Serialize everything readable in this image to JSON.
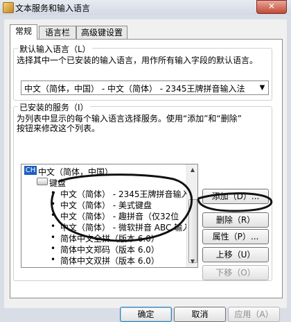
{
  "window": {
    "title": "文本服务和输入语言",
    "close_label": "✕"
  },
  "tabs": [
    {
      "label": "常规"
    },
    {
      "label": "语言栏"
    },
    {
      "label": "高级键设置"
    }
  ],
  "default_language": {
    "title": "默认输入语言（L）",
    "description": "选择其中一个已安装的输入语言，用作所有输入字段的默认语言。",
    "selected": "中文（简体，中国） - 中文（简体） - 2345王牌拼音输入法"
  },
  "installed_services": {
    "title": "已安装的服务（I）",
    "description_1": "为列表中显示的每个输入语言选择服务。使用“添加”和“删除”",
    "description_2": "按钮来修改这个列表。",
    "language_code": "CH",
    "tree": [
      {
        "label": "中文（简体，中国）"
      },
      {
        "label": "键盘"
      },
      {
        "label": "中文（简体） - 2345王牌拼音输入"
      },
      {
        "label": "中文（简体） - 美式键盘"
      },
      {
        "label": "中文（简体） - 趣拼音（仅32位"
      },
      {
        "label": "中文（简体） - 微软拼音 ABC 输入"
      },
      {
        "label": "简体中文全拼（版本 6.0）"
      },
      {
        "label": "简体中文郑码（版本 6.0）"
      },
      {
        "label": "简体中文双拼（版本 6.0）"
      }
    ]
  },
  "buttons": {
    "add": "添加（D）...",
    "remove": "删除（R）",
    "properties": "属性（P）...",
    "move_up": "上移（U）",
    "move_down": "下移（O）"
  },
  "footer": {
    "ok": "确定",
    "cancel": "取消",
    "apply": "应用（A）"
  },
  "icons": {
    "app": "window-app-icon",
    "close": "close-icon",
    "dropdown": "chevron-down-icon",
    "keyboard": "keyboard-icon"
  }
}
